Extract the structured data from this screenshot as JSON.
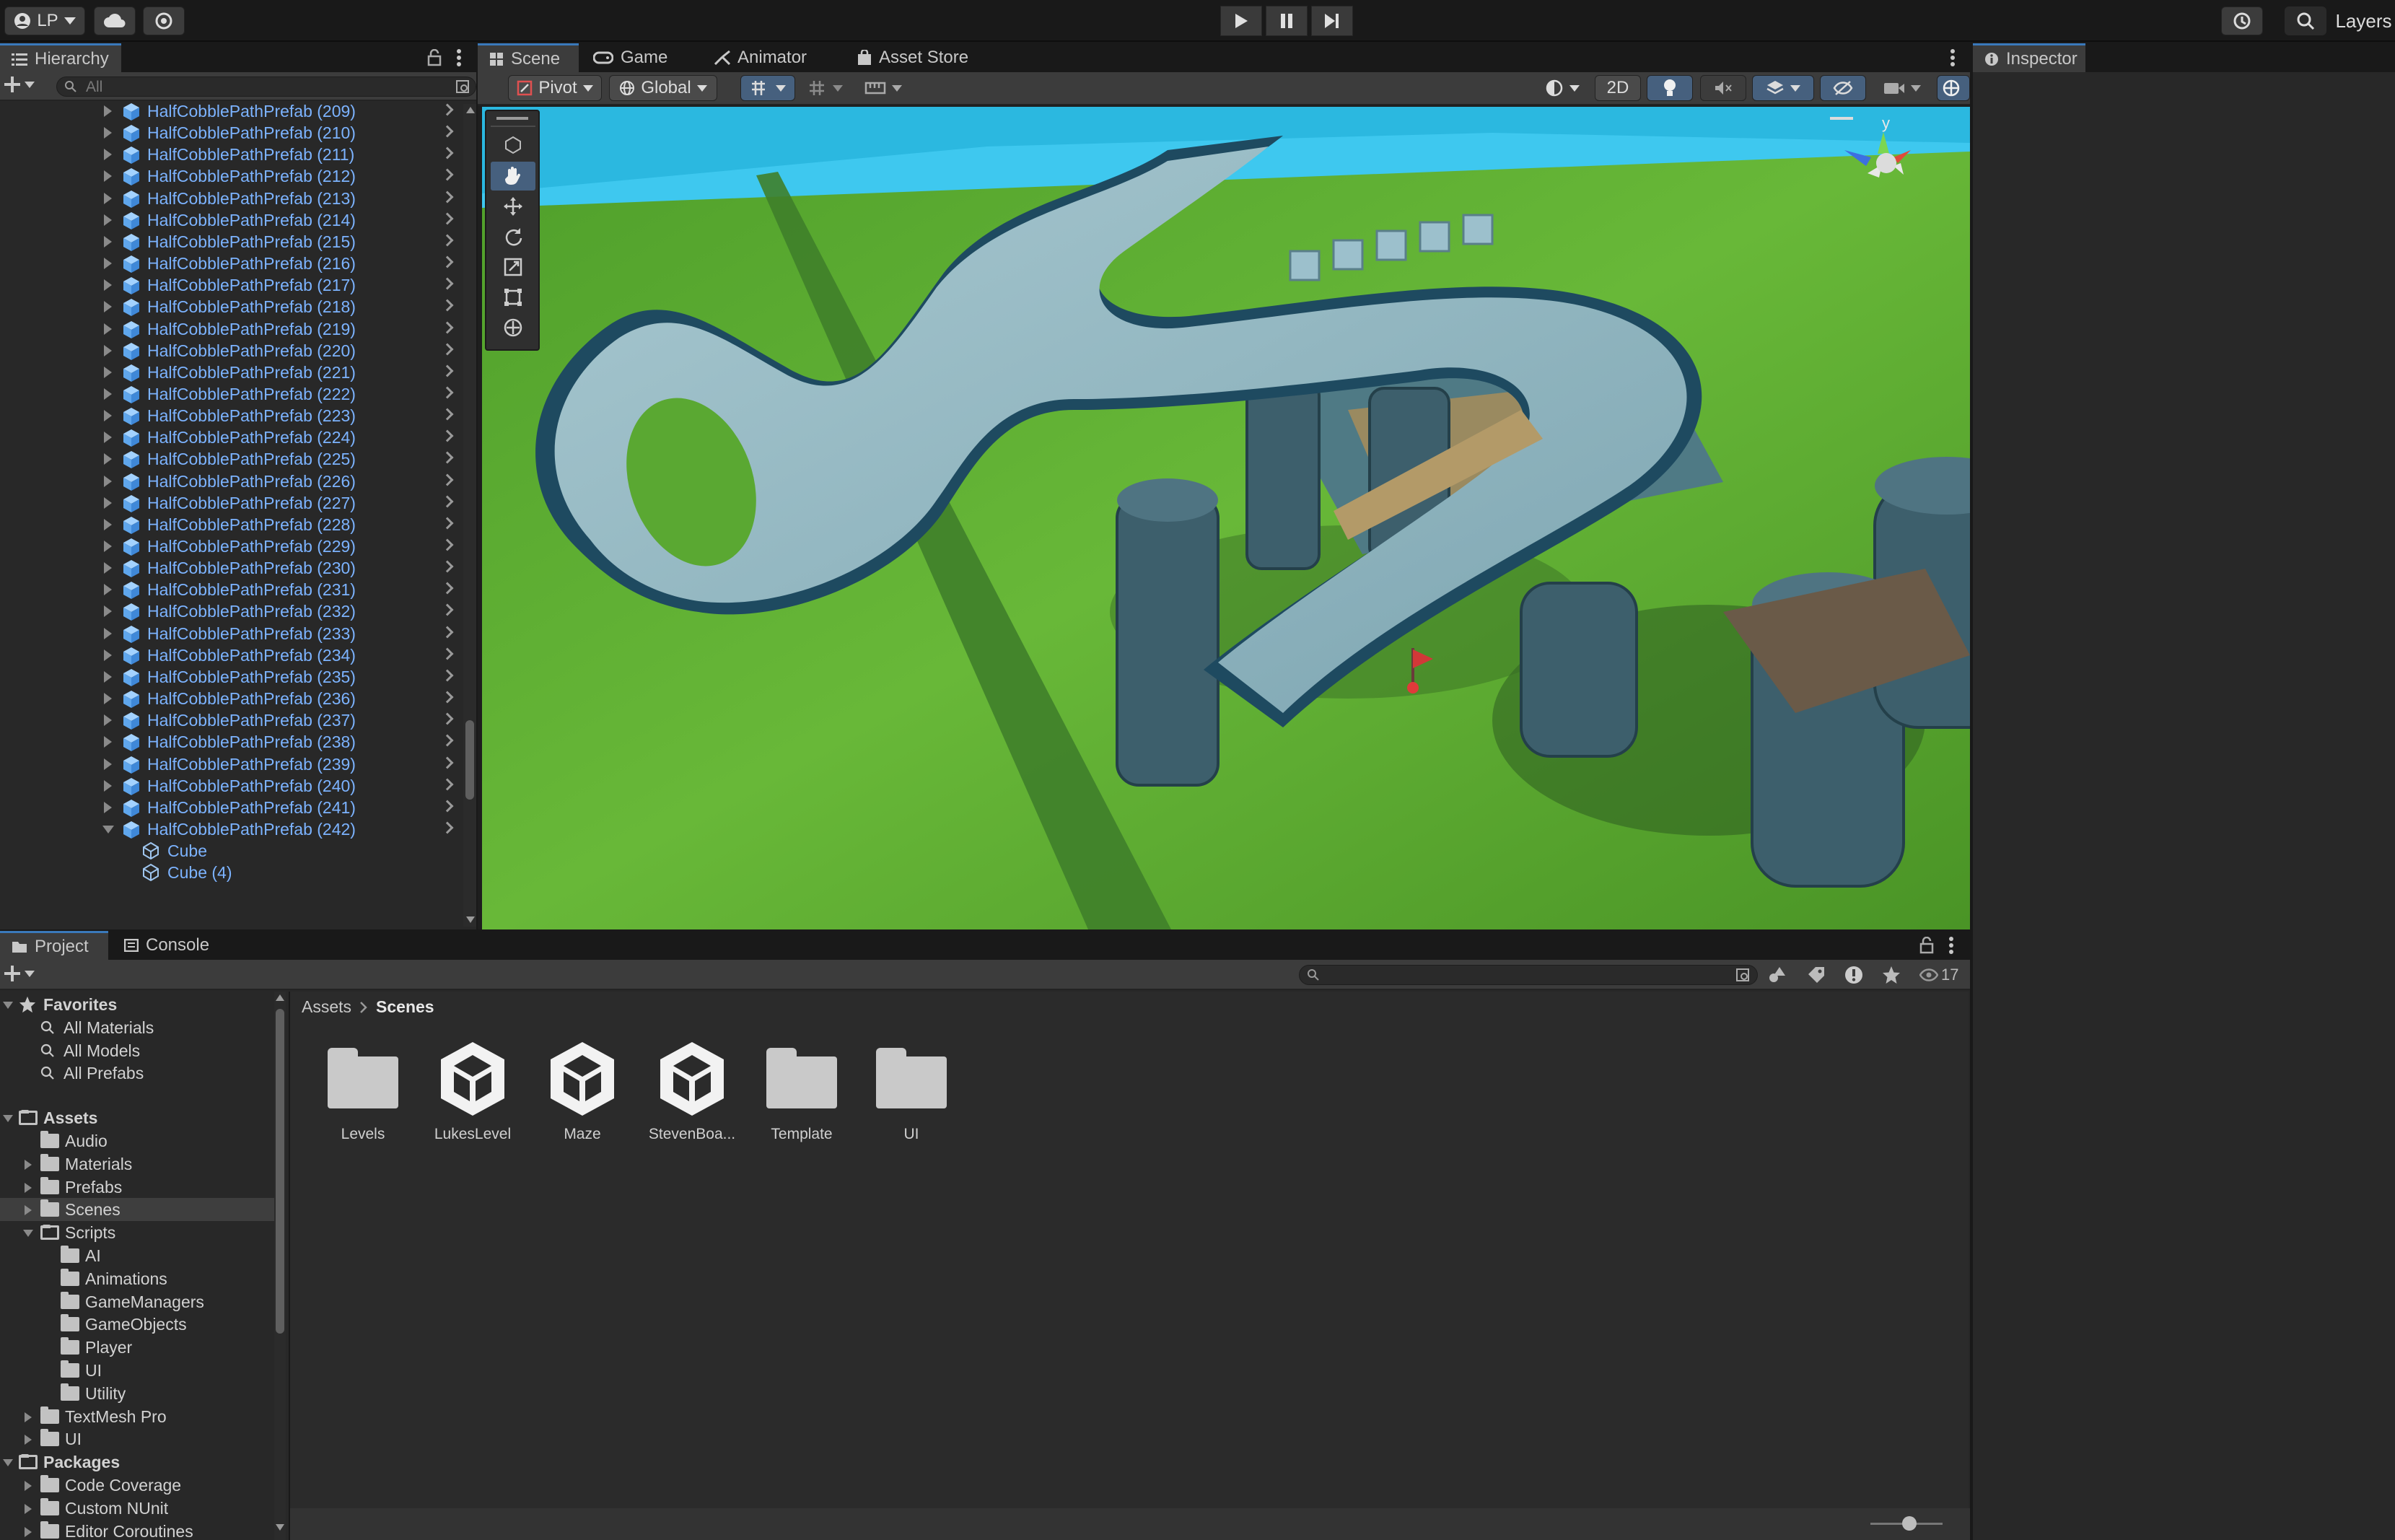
{
  "topbar": {
    "account_label": "LP",
    "layers_label": "Layers"
  },
  "hierarchy": {
    "tab_label": "Hierarchy",
    "search_placeholder": "All",
    "items": [
      "HalfCobblePathPrefab (209)",
      "HalfCobblePathPrefab (210)",
      "HalfCobblePathPrefab (211)",
      "HalfCobblePathPrefab (212)",
      "HalfCobblePathPrefab (213)",
      "HalfCobblePathPrefab (214)",
      "HalfCobblePathPrefab (215)",
      "HalfCobblePathPrefab (216)",
      "HalfCobblePathPrefab (217)",
      "HalfCobblePathPrefab (218)",
      "HalfCobblePathPrefab (219)",
      "HalfCobblePathPrefab (220)",
      "HalfCobblePathPrefab (221)",
      "HalfCobblePathPrefab (222)",
      "HalfCobblePathPrefab (223)",
      "HalfCobblePathPrefab (224)",
      "HalfCobblePathPrefab (225)",
      "HalfCobblePathPrefab (226)",
      "HalfCobblePathPrefab (227)",
      "HalfCobblePathPrefab (228)",
      "HalfCobblePathPrefab (229)",
      "HalfCobblePathPrefab (230)",
      "HalfCobblePathPrefab (231)",
      "HalfCobblePathPrefab (232)",
      "HalfCobblePathPrefab (233)",
      "HalfCobblePathPrefab (234)",
      "HalfCobblePathPrefab (235)",
      "HalfCobblePathPrefab (236)",
      "HalfCobblePathPrefab (237)",
      "HalfCobblePathPrefab (238)",
      "HalfCobblePathPrefab (239)",
      "HalfCobblePathPrefab (240)",
      "HalfCobblePathPrefab (241)",
      "HalfCobblePathPrefab (242)"
    ],
    "children": [
      "Cube",
      "Cube (4)"
    ]
  },
  "scene_tabs": {
    "scene": "Scene",
    "game": "Game",
    "animator": "Animator",
    "asset_store": "Asset Store"
  },
  "scene_toolbar": {
    "pivot": "Pivot",
    "global": "Global",
    "mode_2d": "2D"
  },
  "gizmo": {
    "axis_y": "y"
  },
  "inspector": {
    "tab_label": "Inspector"
  },
  "project": {
    "tab_project": "Project",
    "tab_console": "Console",
    "hidden_count": "17",
    "breadcrumb": [
      "Assets",
      "Scenes"
    ],
    "tree": {
      "favorites": "Favorites",
      "fav_items": [
        "All Materials",
        "All Models",
        "All Prefabs"
      ],
      "assets": "Assets",
      "asset_folders": [
        "Audio",
        "Materials",
        "Prefabs",
        "Scenes",
        "Scripts"
      ],
      "script_folders": [
        "AI",
        "Animations",
        "GameManagers",
        "GameObjects",
        "Player",
        "UI",
        "Utility"
      ],
      "more_folders": [
        "TextMesh Pro",
        "UI"
      ],
      "packages": "Packages",
      "package_folders": [
        "Code Coverage",
        "Custom NUnit",
        "Editor Coroutines"
      ]
    },
    "grid_items": [
      {
        "name": "Levels",
        "kind": "folder"
      },
      {
        "name": "LukesLevel",
        "kind": "scene"
      },
      {
        "name": "Maze",
        "kind": "scene"
      },
      {
        "name": "StevenBoa...",
        "kind": "scene"
      },
      {
        "name": "Template",
        "kind": "folder"
      },
      {
        "name": "UI",
        "kind": "folder"
      }
    ]
  },
  "colors": {
    "accent": "#3a79bb",
    "prefab_text": "#7cb3ff",
    "panel_bg": "#282828",
    "toolbar_bg": "#3c3c3c",
    "grass": "#5aa832",
    "sky": "#2bb8e0"
  }
}
